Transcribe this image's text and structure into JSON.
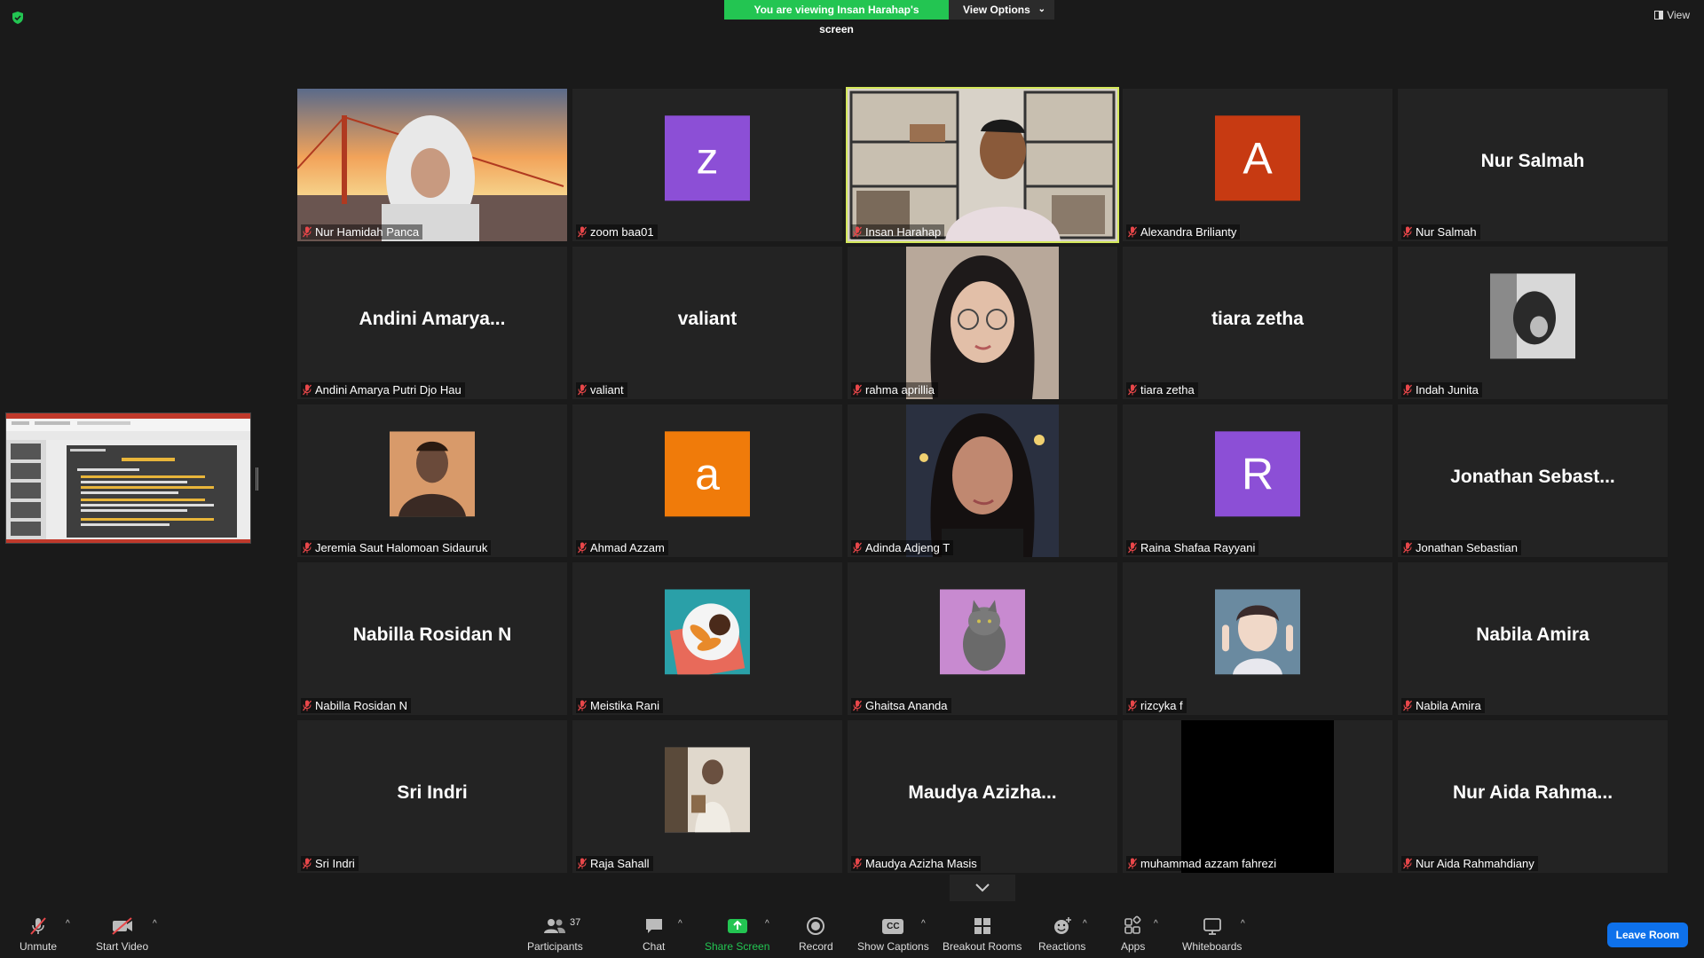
{
  "banner": {
    "text": "You are viewing Insan Harahap's screen",
    "view_options": "View Options"
  },
  "view_button": "View",
  "participants": [
    {
      "name": "Nur Hamidah Panca",
      "type": "video-bridge"
    },
    {
      "name": "zoom baa01",
      "type": "avatar",
      "initial": "z",
      "color": "#8c4fd6"
    },
    {
      "name": "Insan Harahap",
      "type": "video-office",
      "active": true
    },
    {
      "name": "Alexandra Brilianty",
      "type": "avatar",
      "initial": "A",
      "color": "#c73a12"
    },
    {
      "name": "Nur Salmah",
      "type": "text",
      "display": "Nur Salmah"
    },
    {
      "name": "Andini Amarya Putri Djo Hau",
      "type": "text",
      "display": "Andini  Amarya..."
    },
    {
      "name": "valiant",
      "type": "text",
      "display": "valiant"
    },
    {
      "name": "rahma aprillia",
      "type": "video-portrait"
    },
    {
      "name": "tiara zetha",
      "type": "text",
      "display": "tiara zetha"
    },
    {
      "name": "Indah Junita",
      "type": "photo-bw"
    },
    {
      "name": "Jeremia Saut Halomoan Sidauruk",
      "type": "photo-warm"
    },
    {
      "name": "Ahmad Azzam",
      "type": "avatar",
      "initial": "a",
      "color": "#f07b0a"
    },
    {
      "name": "Adinda Adjeng T",
      "type": "video-portrait2"
    },
    {
      "name": "Raina Shafaa Rayyani",
      "type": "avatar",
      "initial": "R",
      "color": "#8c4fd6"
    },
    {
      "name": "Jonathan Sebastian",
      "type": "text",
      "display": "Jonathan  Sebast..."
    },
    {
      "name": "Nabilla Rosidan N",
      "type": "text",
      "display": "Nabilla Rosidan N"
    },
    {
      "name": "Meistika Rani",
      "type": "photo-food"
    },
    {
      "name": "Ghaitsa Ananda",
      "type": "photo-cat"
    },
    {
      "name": "rizcyka f",
      "type": "photo-peace"
    },
    {
      "name": "Nabila Amira",
      "type": "text",
      "display": "Nabila Amira"
    },
    {
      "name": "Sri Indri",
      "type": "text",
      "display": "Sri Indri"
    },
    {
      "name": "Raja Sahall",
      "type": "photo-sepia"
    },
    {
      "name": "Maudya Azizha Masis",
      "type": "text",
      "display": "Maudya  Azizha..."
    },
    {
      "name": "muhammad azzam fahrezi",
      "type": "black"
    },
    {
      "name": "Nur Aida Rahmahdiany",
      "type": "text",
      "display": "Nur  Aida  Rahma..."
    }
  ],
  "toolbar": {
    "unmute": "Unmute",
    "start_video": "Start Video",
    "participants": "Participants",
    "participant_count": "37",
    "chat": "Chat",
    "share_screen": "Share Screen",
    "record": "Record",
    "show_captions": "Show Captions",
    "cc": "CC",
    "breakout_rooms": "Breakout Rooms",
    "reactions": "Reactions",
    "apps": "Apps",
    "whiteboards": "Whiteboards",
    "leave_room": "Leave Room"
  },
  "colors": {
    "banner_green": "#23c552",
    "active_border": "#d4e85a",
    "leave_blue": "#0e71eb",
    "mic_red": "#e8474a"
  }
}
